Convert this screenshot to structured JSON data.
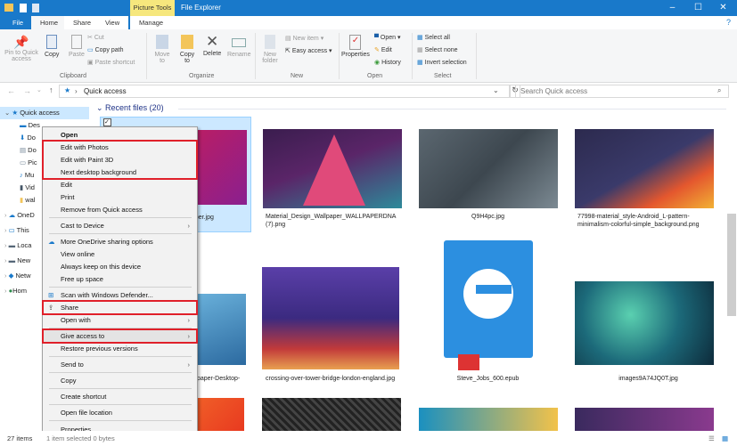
{
  "title": {
    "context_tab": "Picture Tools",
    "app": "File Explorer"
  },
  "tabs": [
    "File",
    "Home",
    "Share",
    "View",
    "Manage"
  ],
  "ribbon": {
    "clipboard": {
      "pin": "Pin to Quick access",
      "copy": "Copy",
      "paste": "Paste",
      "cut": "Cut",
      "copy_path": "Copy path",
      "paste_shortcut": "Paste shortcut",
      "label": "Clipboard"
    },
    "organize": {
      "move": "Move to",
      "copy_to": "Copy to",
      "delete": "Delete",
      "rename": "Rename",
      "label": "Organize"
    },
    "new": {
      "new_folder": "New folder",
      "new_item": "New item",
      "easy_access": "Easy access",
      "label": "New"
    },
    "open": {
      "properties": "Properties",
      "open": "Open",
      "edit": "Edit",
      "history": "History",
      "label": "Open"
    },
    "select": {
      "all": "Select all",
      "none": "Select none",
      "invert": "Invert selection",
      "label": "Select"
    }
  },
  "address": {
    "path": "Quick access",
    "search_placeholder": "Search Quick access"
  },
  "nav": [
    "Quick access",
    "Des",
    "Do",
    "Do",
    "Pic",
    "Mu",
    "Vid",
    "wal",
    "OneD",
    "This",
    "Loca",
    "New",
    "Netw",
    "Hom"
  ],
  "section": "Recent files (20)",
  "files": [
    {
      "name": "...per.jpg"
    },
    {
      "name": "Material_Design_Wallpaper_WALLPAPERDNA (7).png"
    },
    {
      "name": "Q9H4pc.jpg"
    },
    {
      "name": "77998-material_style-Android_L-pattern-minimalism-colorful-simple_background.png"
    },
    {
      "name": "...llpaper-Desktop-"
    },
    {
      "name": "crossing-over-tower-bridge-london-england.jpg"
    },
    {
      "name": "Steve_Jobs_600.epub"
    },
    {
      "name": "images9A74JQ0T.jpg"
    }
  ],
  "menu": [
    "Open",
    "Edit with Photos",
    "Edit with Paint 3D",
    "Next desktop background",
    "Edit",
    "Print",
    "Remove from Quick access",
    "Cast to Device",
    "More OneDrive sharing options",
    "View online",
    "Always keep on this device",
    "Free up space",
    "Scan with Windows Defender...",
    "Share",
    "Open with",
    "Give access to",
    "Restore previous versions",
    "Send to",
    "Copy",
    "Create shortcut",
    "Open file location",
    "Properties"
  ],
  "status": {
    "count": "27 items",
    "selection": "1 item selected  0 bytes"
  },
  "colors": {
    "accent": "#1979ca",
    "highlight": "#e0202a"
  }
}
